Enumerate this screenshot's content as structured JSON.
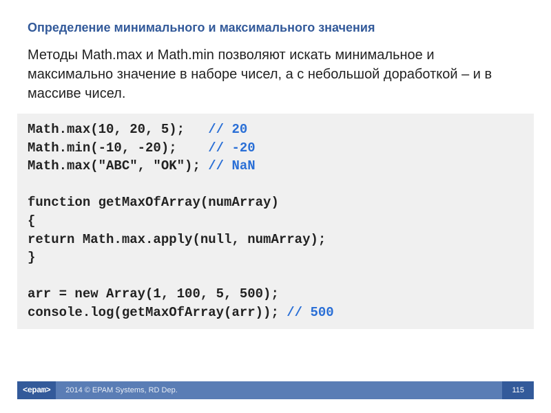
{
  "title": "Определение минимального и максимального значения",
  "body": "Методы Math.max и Math.min позволяют искать минимальное и максимально значение в наборе чисел, а с небольшой доработкой – и в массиве чисел.",
  "code": {
    "l1a": "Math.max(10, 20, 5);   ",
    "l1b": "// 20",
    "l2a": "Math.min(-10, -20);    ",
    "l2b": "// -20",
    "l3a": "Math.max(\"ABC\", \"OK\"); ",
    "l3b": "// NaN",
    "l4": "",
    "l5": "function getMaxOfArray(numArray)",
    "l6": "{",
    "l7": "return Math.max.apply(null, numArray);",
    "l8": "}",
    "l9": "",
    "l10": "arr = new Array(1, 100, 5, 500);",
    "l11a": "console.log(getMaxOfArray(arr)); ",
    "l11b": "// 500"
  },
  "footer": {
    "logo": "<epam>",
    "copyright": "2014 © EPAM Systems, RD Dep.",
    "page": "115"
  }
}
